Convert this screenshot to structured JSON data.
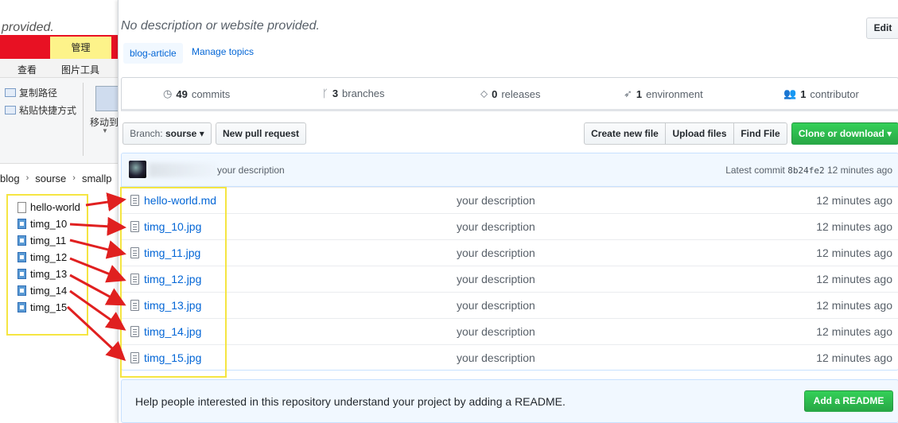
{
  "explorer": {
    "title_fragment": "provided.",
    "tab_manage": "管理",
    "tab_view": "查看",
    "tab_picture_tools": "图片工具",
    "ribbon": {
      "copy_path": "复制路径",
      "paste_shortcut": "粘贴快捷方式",
      "move_to": "移动到"
    },
    "breadcrumbs": [
      "blog",
      "sourse",
      "smallp"
    ],
    "files": [
      {
        "name": "hello-world",
        "type": "doc"
      },
      {
        "name": "timg_10",
        "type": "img"
      },
      {
        "name": "timg_11",
        "type": "img"
      },
      {
        "name": "timg_12",
        "type": "img"
      },
      {
        "name": "timg_13",
        "type": "img"
      },
      {
        "name": "timg_14",
        "type": "img"
      },
      {
        "name": "timg_15",
        "type": "img"
      }
    ]
  },
  "repo": {
    "description": "No description or website provided.",
    "edit_label": "Edit",
    "topic": "blog-article",
    "manage_topics": "Manage topics",
    "numbers": {
      "commits_count": "49",
      "commits_label": "commits",
      "branches_count": "3",
      "branches_label": "branches",
      "releases_count": "0",
      "releases_label": "releases",
      "environments_count": "1",
      "environments_label": "environment",
      "contributors_count": "1",
      "contributors_label": "contributor"
    },
    "branch_label": "Branch:",
    "branch_name": "sourse",
    "new_pull_request": "New pull request",
    "create_new_file": "Create new file",
    "upload_files": "Upload files",
    "find_file": "Find File",
    "clone_or_download": "Clone or download",
    "commit": {
      "message": "your description",
      "latest_label": "Latest commit",
      "sha": "8b24fe2",
      "age": "12 minutes ago"
    },
    "files": [
      {
        "name": "hello-world.md",
        "message": "your description",
        "age": "12 minutes ago"
      },
      {
        "name": "timg_10.jpg",
        "message": "your description",
        "age": "12 minutes ago"
      },
      {
        "name": "timg_11.jpg",
        "message": "your description",
        "age": "12 minutes ago"
      },
      {
        "name": "timg_12.jpg",
        "message": "your description",
        "age": "12 minutes ago"
      },
      {
        "name": "timg_13.jpg",
        "message": "your description",
        "age": "12 minutes ago"
      },
      {
        "name": "timg_14.jpg",
        "message": "your description",
        "age": "12 minutes ago"
      },
      {
        "name": "timg_15.jpg",
        "message": "your description",
        "age": "12 minutes ago"
      }
    ],
    "readme_prompt": "Help people interested in this repository understand your project by adding a README.",
    "add_readme": "Add a README"
  },
  "colors": {
    "annotation_box": "#f5e542",
    "annotation_arrow": "#e02020",
    "link": "#0366d6",
    "primary_button": "#28a745",
    "explorer_red": "#e81123"
  },
  "icons": [
    "history-icon",
    "branch-icon",
    "tag-icon",
    "rocket-icon",
    "people-icon",
    "file-icon",
    "image-file-icon",
    "caret-down-icon"
  ]
}
